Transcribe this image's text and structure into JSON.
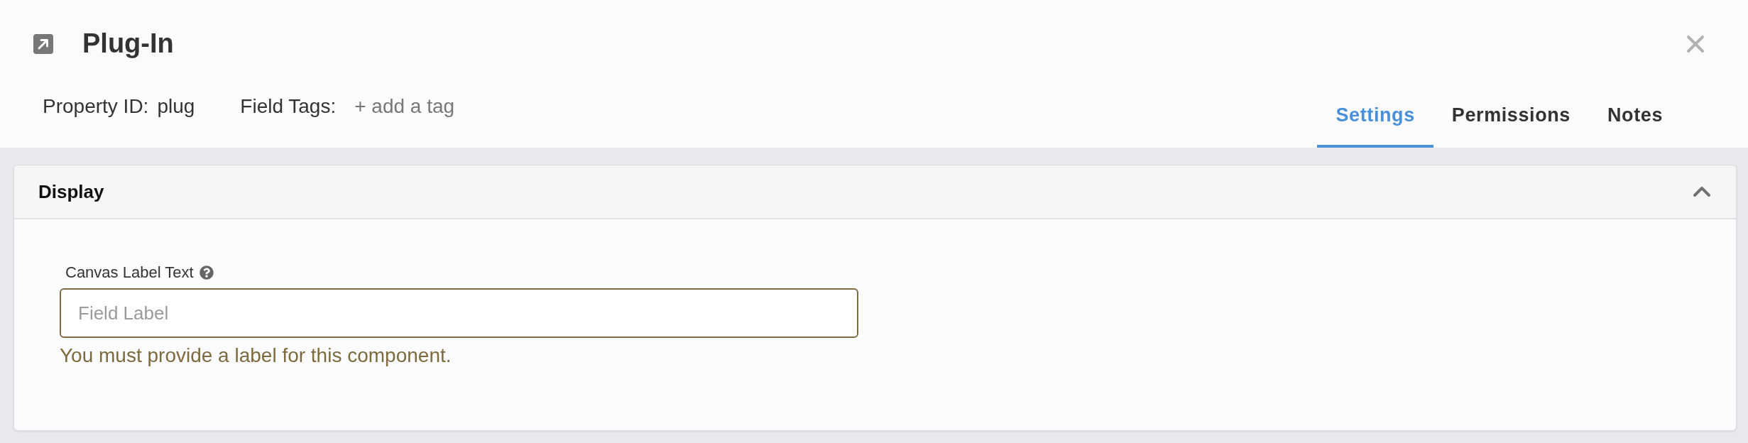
{
  "header": {
    "title": "Plug-In",
    "property_id": {
      "label": "Property ID:",
      "value": "plug"
    },
    "field_tags": {
      "label": "Field Tags:",
      "add_link": "+ add a tag"
    }
  },
  "tabs": [
    {
      "label": "Settings",
      "selected": true
    },
    {
      "label": "Permissions",
      "selected": false
    },
    {
      "label": "Notes",
      "selected": false
    }
  ],
  "sections": [
    {
      "title": "Display",
      "expanded": true,
      "fields": [
        {
          "label": "Canvas Label Text",
          "placeholder": "Field Label",
          "error": "You must provide a label for this component."
        }
      ]
    }
  ]
}
